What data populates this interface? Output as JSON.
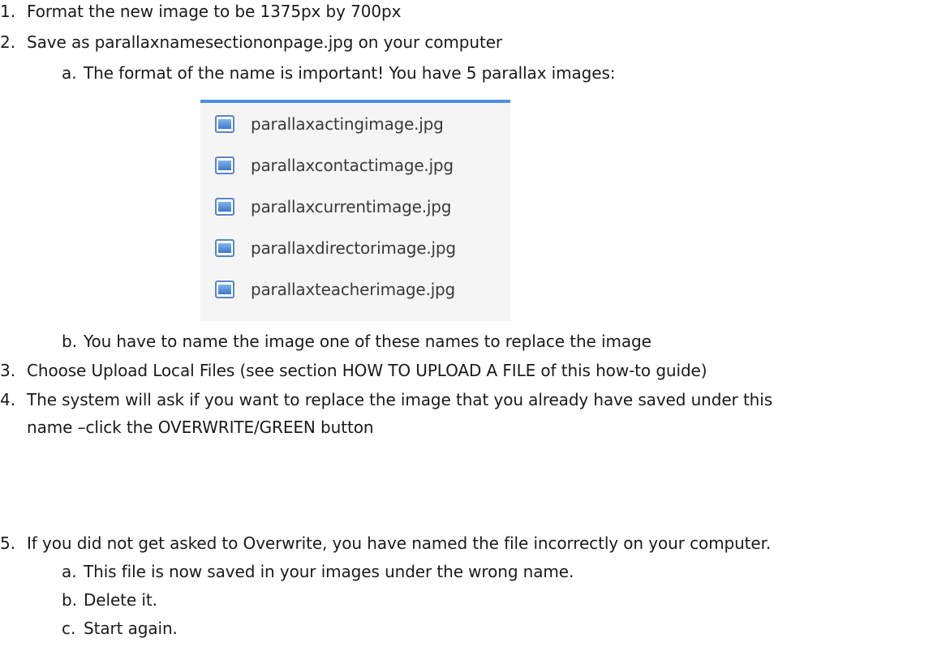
{
  "steps": [
    {
      "num": "1.",
      "text": "Format the new image to be 1375px by 700px"
    },
    {
      "num": "2.",
      "text": "Save as parallaxnamesectiononpage.jpg on your computer"
    },
    {
      "num": "a.",
      "text": "The format of the name is important!  You have 5 parallax images:"
    },
    {
      "num": "b.",
      "text": "You have to name the image one of these names to replace the image"
    },
    {
      "num": "3.",
      "text": "Choose Upload Local Files (see section HOW TO UPLOAD A FILE of this how-to guide)"
    },
    {
      "num": "4.",
      "text": "The system will ask if you want to replace the image that you already have saved under this"
    },
    {
      "num": "",
      "text": "name –click the OVERWRITE/GREEN button"
    },
    {
      "num": "5.",
      "text": "If you did not get asked to Overwrite, you have named the file incorrectly on your computer."
    },
    {
      "num": "a.",
      "text": "This file is now saved in your images under the wrong name."
    },
    {
      "num": "b.",
      "text": "Delete it."
    },
    {
      "num": "c.",
      "text": "Start again."
    }
  ],
  "file_list": {
    "icon": "image-file-icon",
    "files": [
      "parallaxactingimage.jpg",
      "parallaxcontactimage.jpg",
      "parallaxcurrentimage.jpg",
      "parallaxdirectorimage.jpg",
      "parallaxteacherimage.jpg"
    ]
  }
}
